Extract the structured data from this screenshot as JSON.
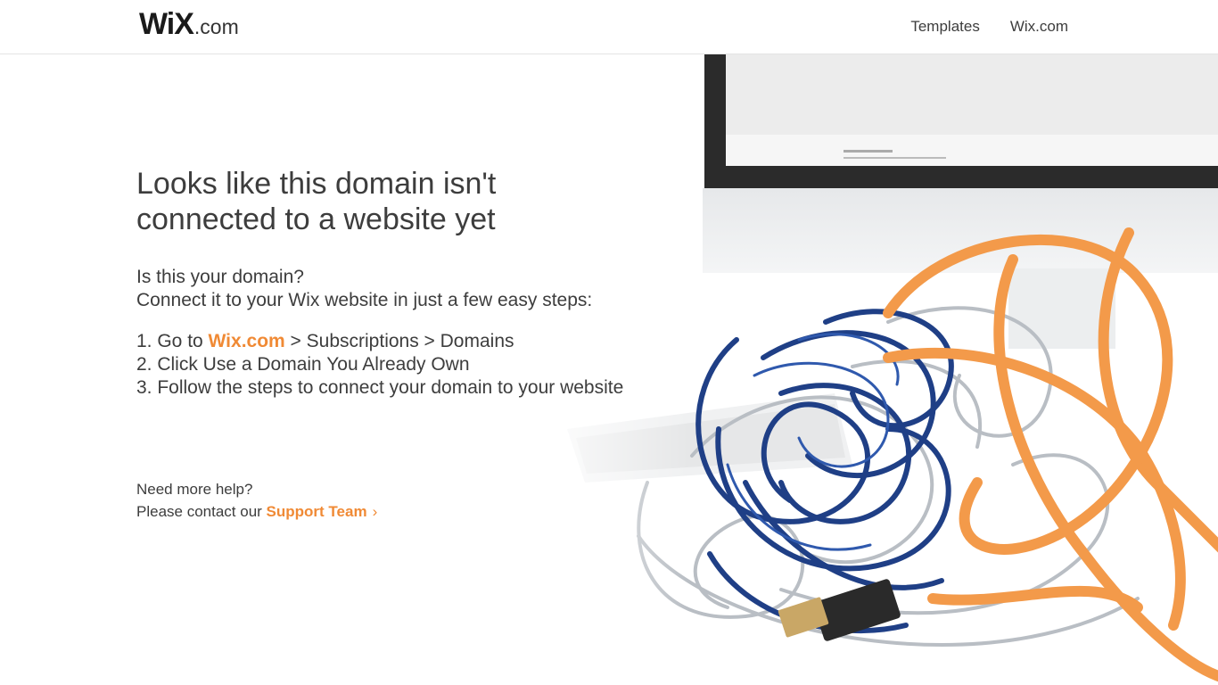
{
  "header": {
    "logo_main": "WiX",
    "logo_suffix": ".com",
    "nav": [
      "Templates",
      "Wix.com"
    ]
  },
  "main": {
    "title_line1": "Looks like this domain isn't",
    "title_line2": "connected to a website yet",
    "question": "Is this your domain?",
    "subtitle": "Connect it to your Wix website in just a few easy steps:",
    "steps": {
      "s1_prefix": "1. Go to ",
      "s1_link": "Wix.com",
      "s1_suffix": " > Subscriptions > Domains",
      "s2": "2. Click Use a Domain You Already Own",
      "s3": "3. Follow the steps to connect your domain to your website"
    },
    "help_q": "Need more help?",
    "help_prefix": "Please contact our ",
    "help_link": "Support Team",
    "help_chevron": "›"
  },
  "colors": {
    "accent": "#f08a35",
    "text": "#3d3d3d",
    "cable_blue": "#1f3f86",
    "cable_orange": "#f39a4a"
  },
  "icons": [
    "chevron-right-icon"
  ]
}
